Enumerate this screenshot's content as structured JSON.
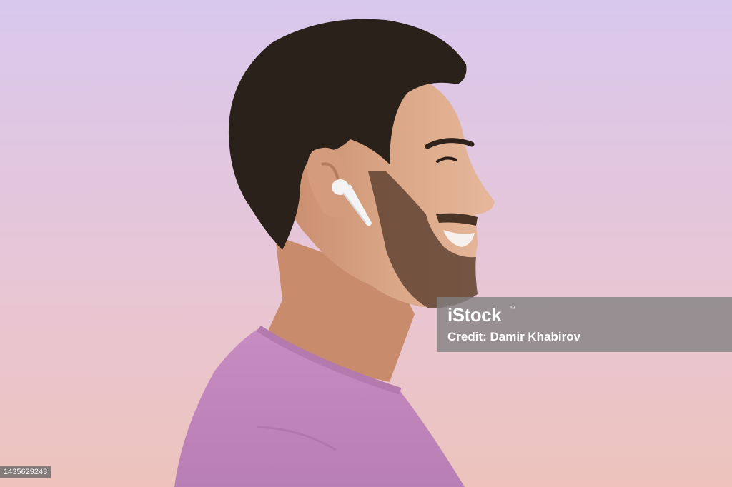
{
  "watermark": {
    "brand": "iStock",
    "trademark": "™",
    "credit": "Credit: Damir Khabirov"
  },
  "image_id": "1435629243",
  "colors": {
    "background_top": "#d9c8ee",
    "background_bottom": "#edc3bc",
    "shirt": "#c98fc4",
    "skin": "#d9a585",
    "hair": "#2b211b",
    "earbud": "#f4f4f4"
  }
}
